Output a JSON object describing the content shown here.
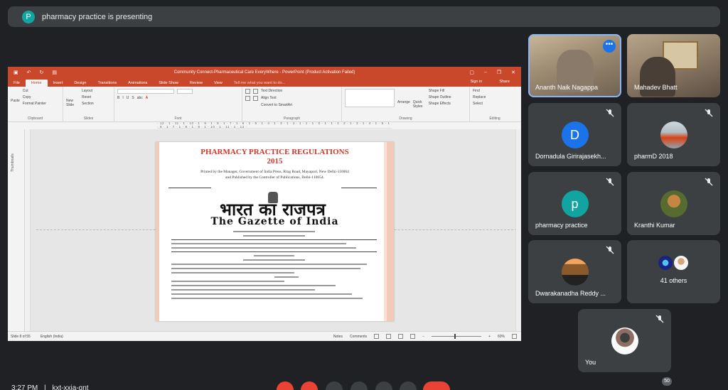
{
  "banner": {
    "avatar_letter": "P",
    "text": "pharmacy practice is presenting"
  },
  "ppt": {
    "window_title": "Community Connect-Pharmaceutical Care EveryWhere - PowerPoint (Product Activation Failed)",
    "tabs": [
      "File",
      "Home",
      "Insert",
      "Design",
      "Transitions",
      "Animations",
      "Slide Show",
      "Review",
      "View"
    ],
    "active_tab": "Home",
    "tell_me": "Tell me what you want to do...",
    "sign_in": "Sign in",
    "share": "Share",
    "groups": {
      "clipboard": {
        "name": "Clipboard",
        "paste": "Paste",
        "cut": "Cut",
        "copy": "Copy",
        "format_painter": "Format Painter"
      },
      "slides": {
        "name": "Slides",
        "new_slide": "New Slide",
        "layout": "Layout",
        "reset": "Reset",
        "section": "Section"
      },
      "font": {
        "name": "Font"
      },
      "paragraph": {
        "name": "Paragraph",
        "text_direction": "Text Direction",
        "align_text": "Align Text",
        "smartart": "Convert to SmartArt"
      },
      "drawing": {
        "name": "Drawing",
        "arrange": "Arrange",
        "quick_styles": "Quick Styles",
        "shape_fill": "Shape Fill",
        "shape_outline": "Shape Outline",
        "shape_effects": "Shape Effects"
      },
      "editing": {
        "name": "Editing",
        "find": "Find",
        "replace": "Replace",
        "select": "Select"
      }
    },
    "ruler": "· 12 · 1 · 11 · 1 · 10 · 1 · 9 · 1 · 8 · 1 · 7 · 1 · 6 · 1 · 5 · 1 · 4 · 1 · 3 · 1 · 2 · 1 · 1 · 1 · 0 · 1 · 1 · 1 · 2 · 1 · 3 · 1 · 4 · 1 · 5 · 1 · 6 · 1 · 7 · 1 · 8 · 1 · 9 · 1 · 10 · 1 · 11 · 1 · 12 ·",
    "thumbnails_label": "Thumbnails",
    "slide": {
      "title_line1": "PHARMACY PRACTICE REGULATIONS",
      "title_line2": "2015",
      "printed_line1": "Printed by the Manager, Government of India Press, Ring Road, Mayapuri, New Delhi-110064",
      "printed_line2": "and Published by the Controller of Publications, Delhi-110054.",
      "hindi_title": "भारत का राजपत्र",
      "gazette": "The Gazette of India"
    },
    "status": {
      "slide_count": "Slide 8 of 55",
      "language": "English (India)",
      "notes": "Notes",
      "comments": "Comments",
      "zoom": "60%"
    }
  },
  "participants": [
    {
      "name": "Ananth Naik Nagappa",
      "type": "video"
    },
    {
      "name": "Mahadev Bhatt",
      "type": "video"
    },
    {
      "name": "Dornadula Girirajasekh...",
      "avatar_letter": "D",
      "avatar_color": "#1a73e8"
    },
    {
      "name": "pharmD 2018",
      "avatar_color": "#b0bec5"
    },
    {
      "name": "pharmacy practice",
      "avatar_letter": "p",
      "avatar_color": "#12a4a0"
    },
    {
      "name": "Kranthi Kumar",
      "avatar_color": "#6b8e23"
    },
    {
      "name": "Dwarakanadha Reddy ...",
      "avatar_color": "#a0522d"
    },
    {
      "name": "41 others"
    },
    {
      "name": "You",
      "avatar_color": "#e0e0e0"
    }
  ],
  "toolbar": {
    "time": "3:27 PM",
    "meeting_code": "kxt-xxja-gnt",
    "participant_badge": "50"
  },
  "colors": {
    "accent": "#8ab4f8",
    "danger": "#ea4335",
    "ppt_orange": "#c9472a"
  }
}
